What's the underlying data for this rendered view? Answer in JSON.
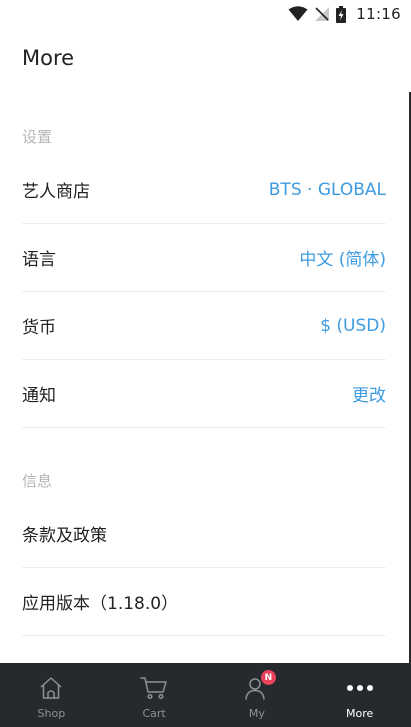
{
  "status_bar": {
    "time": "11:16"
  },
  "header": {
    "title": "More"
  },
  "sections": [
    {
      "label": "设置",
      "rows": [
        {
          "label": "艺人商店",
          "value": "BTS · GLOBAL"
        },
        {
          "label": "语言",
          "value": "中文 (简体)"
        },
        {
          "label": "货币",
          "value": "$ (USD)"
        },
        {
          "label": "通知",
          "value": "更改"
        }
      ]
    },
    {
      "label": "信息",
      "rows": [
        {
          "label": "条款及政策"
        },
        {
          "label": "应用版本（1.18.0）"
        }
      ]
    }
  ],
  "tab_bar": {
    "tabs": [
      {
        "label": "Shop",
        "icon": "home-icon"
      },
      {
        "label": "Cart",
        "icon": "cart-icon"
      },
      {
        "label": "My",
        "icon": "user-icon",
        "badge": "N"
      },
      {
        "label": "More",
        "icon": "more-icon",
        "active": true
      }
    ]
  },
  "colors": {
    "accent": "#3d9be0",
    "tab_bar_bg": "#262a2e",
    "badge": "#e8435a"
  }
}
